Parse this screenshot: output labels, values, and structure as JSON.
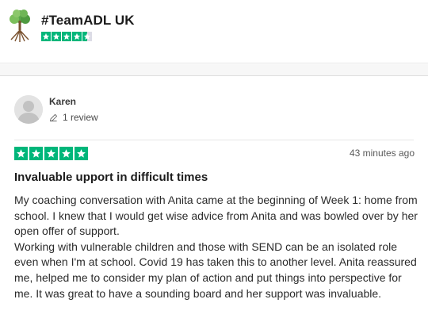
{
  "company": {
    "name": "#TeamADL UK",
    "trust_rating": 4.5,
    "logo_icon": "tree-roots-logo",
    "star_color": "#00b67a"
  },
  "review": {
    "reviewer_name": "Karen",
    "review_count_label": "1 review",
    "avatar_icon": "user-silhouette-icon",
    "stars": 5,
    "date": "43 minutes ago",
    "title": "Invaluable upport in difficult times",
    "body": [
      "My coaching conversation with Anita came at the beginning of Week 1: home from school. I knew that I would get wise advice from Anita and was bowled over by her open offer of support.",
      "Working with vulnerable children and those with SEND can be an isolated role even when I'm at school. Covid 19 has taken this to another level. Anita reassured me, helped me to consider my plan of action and put things into perspective for me. It was great to have a sounding board and her support was invaluable."
    ]
  }
}
